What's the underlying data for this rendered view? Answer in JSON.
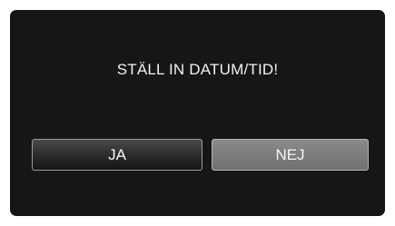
{
  "dialog": {
    "message": "STÄLL IN DATUM/TID!",
    "yes_label": "JA",
    "no_label": "NEJ"
  },
  "colors": {
    "screen_background": "#161616",
    "yes_button": "#2c2c2c",
    "no_button_selected": "#7a7a7a",
    "text": "#f2f2f2"
  }
}
